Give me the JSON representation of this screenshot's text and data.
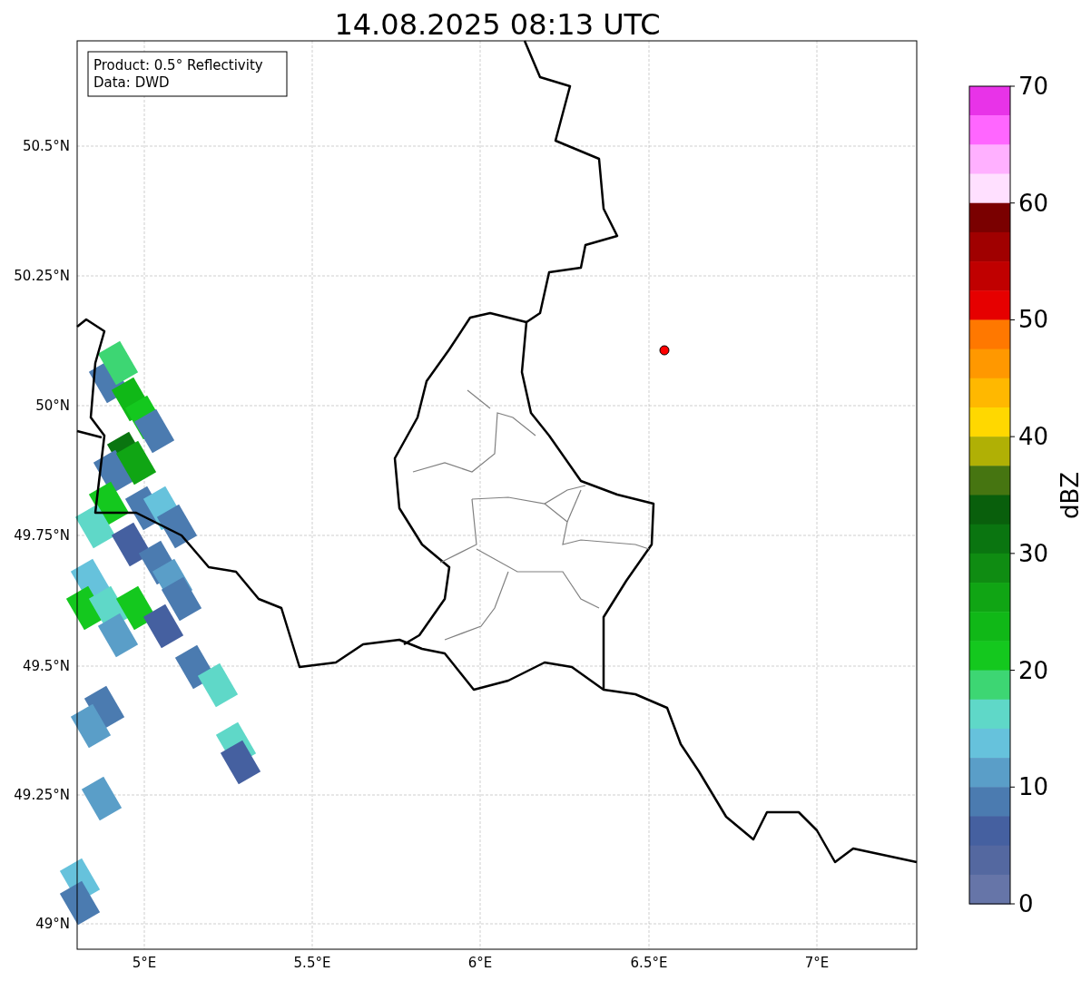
{
  "title": "14.08.2025 08:13 UTC",
  "info_box": {
    "lines": [
      "Product: 0.5° Reflectivity",
      "Data: DWD"
    ]
  },
  "lon_ticks": [
    "5°E",
    "5.5°E",
    "6°E",
    "6.5°E",
    "7°E"
  ],
  "lat_ticks": [
    "50.5°N",
    "50.25°N",
    "50°N",
    "49.75°N",
    "49.5°N",
    "49.25°N",
    "49°N"
  ],
  "colorbar": {
    "label": "dBZ",
    "ticks": [
      "70",
      "60",
      "50",
      "40",
      "30",
      "20",
      "10",
      "0"
    ],
    "bins": [
      {
        "color": "#e833e8"
      },
      {
        "color": "#ff66ff"
      },
      {
        "color": "#ffb0ff"
      },
      {
        "color": "#ffe0ff"
      },
      {
        "color": "#7a0000"
      },
      {
        "color": "#a00000"
      },
      {
        "color": "#c00000"
      },
      {
        "color": "#e60000"
      },
      {
        "color": "#ff7800"
      },
      {
        "color": "#ff9800"
      },
      {
        "color": "#ffb800"
      },
      {
        "color": "#ffd800"
      },
      {
        "color": "#b0b005"
      },
      {
        "color": "#467511"
      },
      {
        "color": "#095f0c"
      },
      {
        "color": "#0a7510"
      },
      {
        "color": "#0f8c12"
      },
      {
        "color": "#10a514"
      },
      {
        "color": "#10b817"
      },
      {
        "color": "#14c81e"
      },
      {
        "color": "#3dd673"
      },
      {
        "color": "#5fd8c8"
      },
      {
        "color": "#66c2dc"
      },
      {
        "color": "#5a9ec8"
      },
      {
        "color": "#4b7bb0"
      },
      {
        "color": "#4560a0"
      },
      {
        "color": "#5468a0"
      },
      {
        "color": "#6675a8"
      }
    ]
  }
}
